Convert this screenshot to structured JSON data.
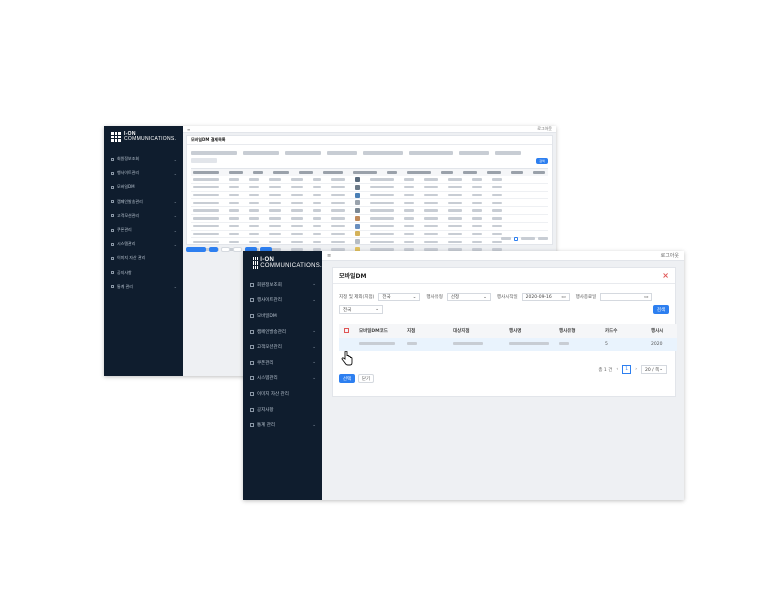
{
  "back_window": {
    "topbar_left": "≡",
    "topbar_right": "로그아웃",
    "panel_title": "모바일DM 결제목록",
    "logo": {
      "line1": "I-ON",
      "line2": "COMMUNICATIONS."
    },
    "menu": [
      {
        "label": "회원정보조회",
        "chevron": "⌄"
      },
      {
        "label": "행사이트관리",
        "chevron": "⌄"
      },
      {
        "label": "모바일DM",
        "chevron": ""
      },
      {
        "label": "캠페인발송관리",
        "chevron": "⌄"
      },
      {
        "label": "고객모션관리",
        "chevron": "⌄"
      },
      {
        "label": "쿠폰관리",
        "chevron": "⌄"
      },
      {
        "label": "시스템관리",
        "chevron": "⌄"
      },
      {
        "label": "이미지 자산 관리",
        "chevron": ""
      },
      {
        "label": "공지사항",
        "chevron": ""
      },
      {
        "label": "통계 관리",
        "chevron": "⌄"
      }
    ],
    "row_count": 10,
    "thumb_colors": [
      "#5a6b7d",
      "#6c7a88",
      "#4a7fb5",
      "#9aa3ad",
      "#7b8894",
      "#c08a5a",
      "#6a8fbf",
      "#d4b25a",
      "#b5bcc4",
      "#e0c060"
    ],
    "search_label": "검색"
  },
  "front_window": {
    "topbar_left": "≡",
    "topbar_right": "로그아웃",
    "logo": {
      "line1": "I-ON",
      "line2": "COMMUNICATIONS."
    },
    "menu": [
      {
        "label": "회원정보조회",
        "chevron": "⌄"
      },
      {
        "label": "행사이트관리",
        "chevron": "⌄"
      },
      {
        "label": "모바일DM",
        "chevron": ""
      },
      {
        "label": "캠페인발송관리",
        "chevron": "⌄"
      },
      {
        "label": "고객모션관리",
        "chevron": "⌄"
      },
      {
        "label": "쿠폰관리",
        "chevron": "⌄"
      },
      {
        "label": "시스템관리",
        "chevron": "⌄"
      },
      {
        "label": "이미지 자산 관리",
        "chevron": ""
      },
      {
        "label": "공지사항",
        "chevron": ""
      },
      {
        "label": "통계 관리",
        "chevron": "⌄"
      }
    ],
    "panel_title": "모바일DM",
    "close_icon": "×",
    "filters": {
      "target_label": "지정 및 제외(지점)",
      "target_value": "전국",
      "type_label": "행사유형",
      "type_value": "선정",
      "start_label": "행사시작일",
      "start_value": "2020-09-16",
      "end_label": "행사종료일",
      "end_value": "",
      "region_value": "전국",
      "search_button": "검색"
    },
    "table": {
      "columns": [
        "",
        "모바일DM코드",
        "지점",
        "대상지점",
        "행사명",
        "행사유형",
        "카드수",
        "행사시"
      ],
      "row": {
        "count": "5",
        "last": "2020"
      }
    },
    "buttons": {
      "select": "선택",
      "cancel": "닫기"
    },
    "pagination": {
      "total": "총 1 건",
      "prev": "‹",
      "current": "1",
      "next": "›",
      "page_size": "20 / 쪽"
    }
  }
}
